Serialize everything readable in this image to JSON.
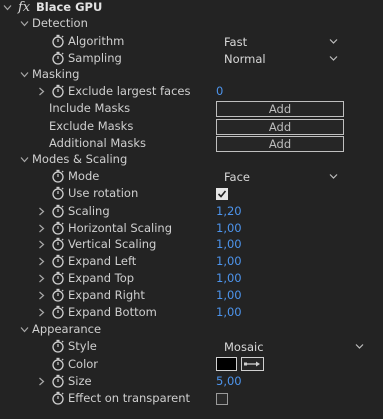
{
  "effect": {
    "fx_label": "fx",
    "name": "Blace GPU"
  },
  "groups": {
    "detection": "Detection",
    "masking": "Masking",
    "modes_scaling": "Modes & Scaling",
    "appearance": "Appearance"
  },
  "params": {
    "algorithm": {
      "label": "Algorithm",
      "value": "Fast"
    },
    "sampling": {
      "label": "Sampling",
      "value": "Normal"
    },
    "exclude_largest_faces": {
      "label": "Exclude largest faces",
      "value": "0"
    },
    "include_masks": {
      "label": "Include Masks",
      "button": "Add"
    },
    "exclude_masks": {
      "label": "Exclude Masks",
      "button": "Add"
    },
    "additional_masks": {
      "label": "Additional Masks",
      "button": "Add"
    },
    "mode": {
      "label": "Mode",
      "value": "Face"
    },
    "use_rotation": {
      "label": "Use rotation",
      "checked": true
    },
    "scaling": {
      "label": "Scaling",
      "value": "1,20"
    },
    "horizontal_scaling": {
      "label": "Horizontal Scaling",
      "value": "1,00"
    },
    "vertical_scaling": {
      "label": "Vertical Scaling",
      "value": "1,00"
    },
    "expand_left": {
      "label": "Expand Left",
      "value": "1,00"
    },
    "expand_top": {
      "label": "Expand Top",
      "value": "1,00"
    },
    "expand_right": {
      "label": "Expand Right",
      "value": "1,00"
    },
    "expand_bottom": {
      "label": "Expand Bottom",
      "value": "1,00"
    },
    "style": {
      "label": "Style",
      "value": "Mosaic"
    },
    "color": {
      "label": "Color",
      "swatch": "#000000"
    },
    "size": {
      "label": "Size",
      "value": "5,00"
    },
    "effect_on_transparent": {
      "label": "Effect on transparent",
      "checked": false
    }
  },
  "colors": {
    "background": "#232323",
    "value_blue": "#4d94ec",
    "text": "#cfcfcf"
  }
}
